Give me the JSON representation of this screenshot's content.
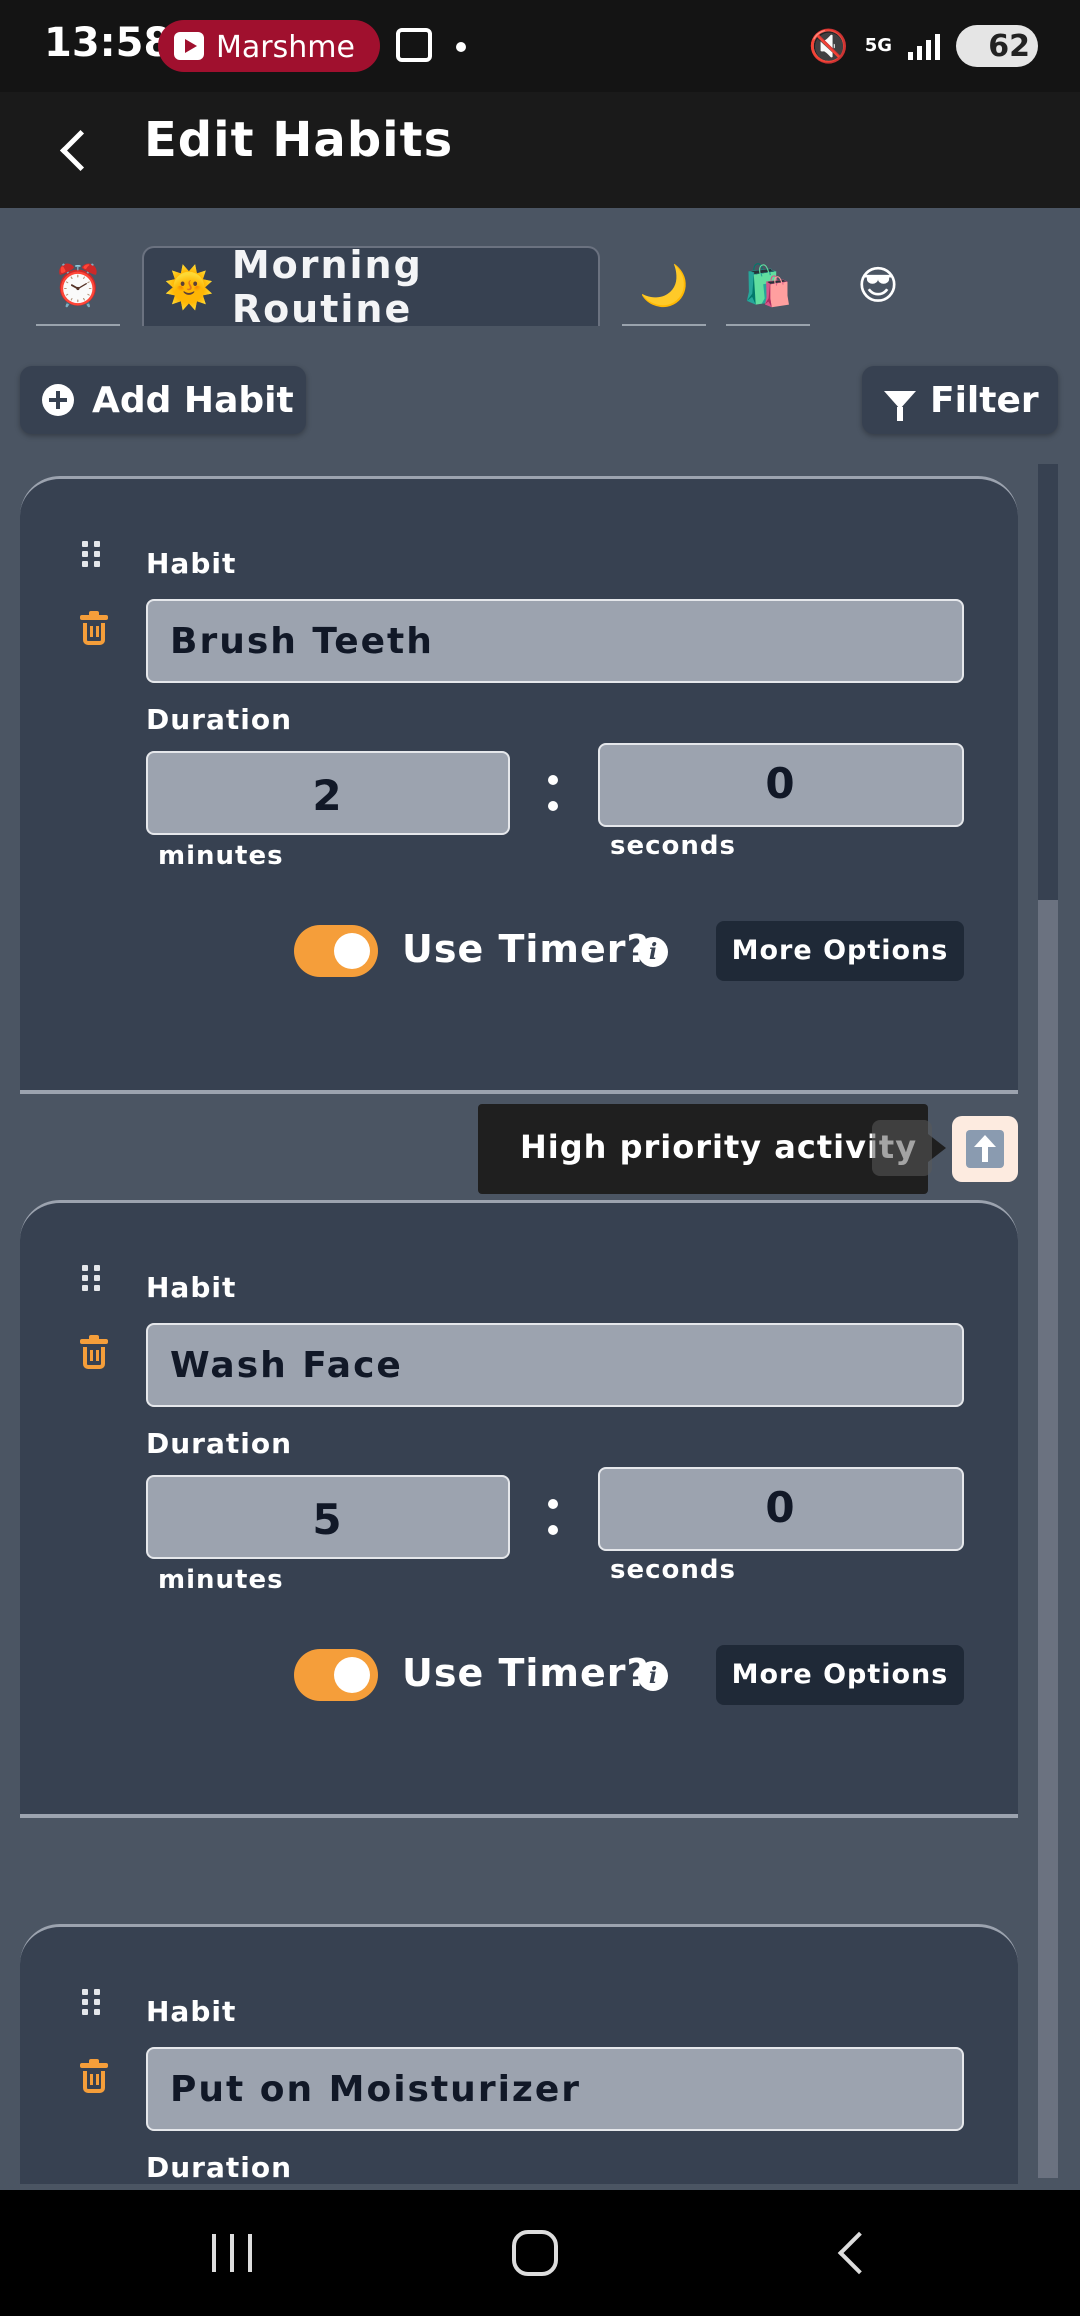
{
  "status_bar": {
    "time": "13:58",
    "app_pill": "Marshme",
    "network": "5G",
    "battery": "62"
  },
  "app_bar": {
    "title": "Edit Habits"
  },
  "tabs": [
    {
      "icon": "⏰",
      "label": "",
      "active": false
    },
    {
      "icon": "🌞",
      "label": "Morning Routine",
      "active": true
    },
    {
      "icon": "🌙",
      "label": "",
      "active": false
    },
    {
      "icon": "🛍️",
      "label": "",
      "active": false
    },
    {
      "icon": "😎",
      "label": "",
      "active": false
    }
  ],
  "actions": {
    "add_habit": "Add Habit",
    "filter": "Filter"
  },
  "labels": {
    "habit": "Habit",
    "duration": "Duration",
    "minutes": "minutes",
    "seconds": "seconds",
    "use_timer": "Use Timer?",
    "info": "i",
    "more_options": "More Options"
  },
  "habits": [
    {
      "name": "Brush Teeth",
      "minutes": "2",
      "seconds": "0",
      "use_timer": true
    },
    {
      "name": "Wash Face",
      "minutes": "5",
      "seconds": "0",
      "use_timer": true
    },
    {
      "name": "Put on Moisturizer"
    }
  ],
  "tooltip": {
    "text": "High priority activity"
  },
  "colors": {
    "accent": "#f59e3a",
    "card": "#374151",
    "background": "#4b5563"
  }
}
